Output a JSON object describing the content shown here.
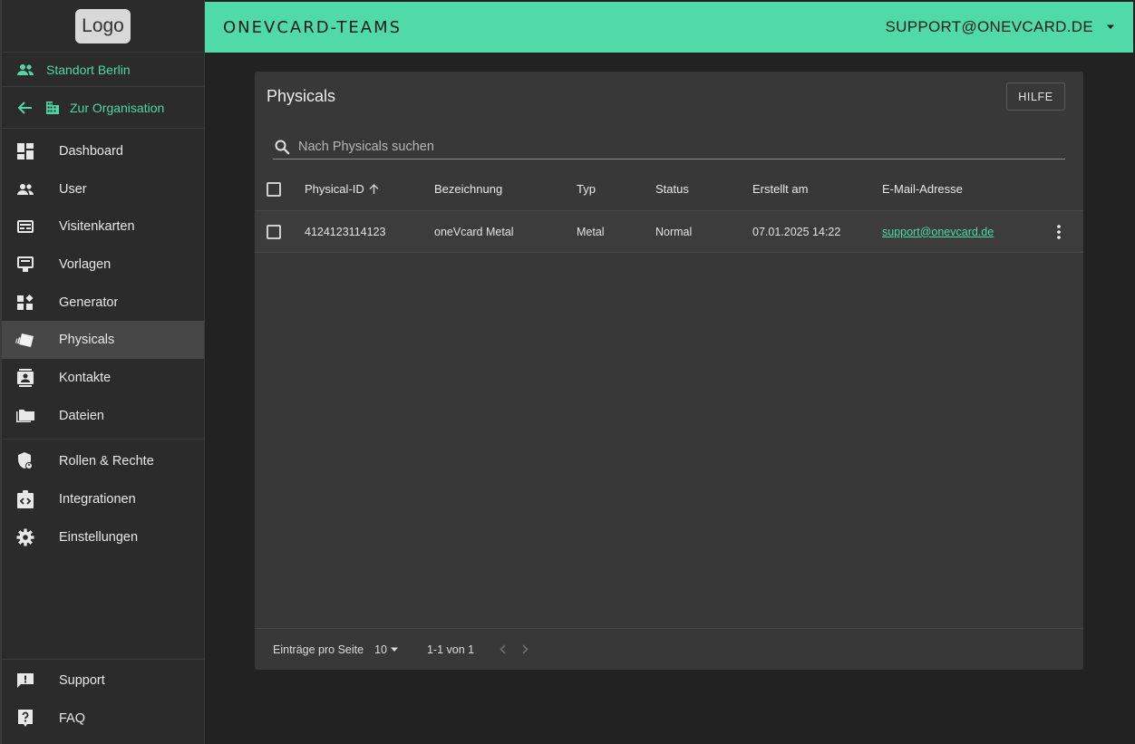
{
  "sidebar": {
    "logo": "Logo",
    "location": "Standort Berlin",
    "back_label": "Zur Organisation",
    "nav_main": [
      {
        "label": "Dashboard",
        "icon": "dashboard-icon"
      },
      {
        "label": "User",
        "icon": "users-icon"
      },
      {
        "label": "Visitenkarten",
        "icon": "card-icon"
      },
      {
        "label": "Vorlagen",
        "icon": "template-icon"
      },
      {
        "label": "Generator",
        "icon": "widgets-icon"
      },
      {
        "label": "Physicals",
        "icon": "nfc-card-icon",
        "active": true
      },
      {
        "label": "Kontakte",
        "icon": "contacts-icon"
      },
      {
        "label": "Dateien",
        "icon": "folder-icon"
      }
    ],
    "nav_admin": [
      {
        "label": "Rollen & Rechte",
        "icon": "shield-icon"
      },
      {
        "label": "Integrationen",
        "icon": "integration-icon"
      },
      {
        "label": "Einstellungen",
        "icon": "gear-icon"
      }
    ],
    "nav_bottom": [
      {
        "label": "Support",
        "icon": "feedback-icon"
      },
      {
        "label": "FAQ",
        "icon": "help-icon"
      }
    ]
  },
  "header": {
    "brand": "ONEVCARD-TEAMS",
    "account": "SUPPORT@ONEVCARD.DE"
  },
  "page": {
    "title": "Physicals",
    "help_label": "HILFE",
    "search_placeholder": "Nach Physicals suchen"
  },
  "table": {
    "columns": [
      "Physical-ID",
      "Bezeichnung",
      "Typ",
      "Status",
      "Erstellt am",
      "E-Mail-Adresse"
    ],
    "rows": [
      {
        "id": "4124123114123",
        "name": "oneVcard Metal",
        "type": "Metal",
        "status": "Normal",
        "created": "07.01.2025 14:22",
        "email": "support@onevcard.de"
      }
    ]
  },
  "pagination": {
    "per_page_label": "Einträge pro Seite",
    "per_page_value": "10",
    "range": "1-1 von 1"
  },
  "colors": {
    "accent": "#4fdaa8",
    "background": "#222222",
    "card": "#383838"
  }
}
